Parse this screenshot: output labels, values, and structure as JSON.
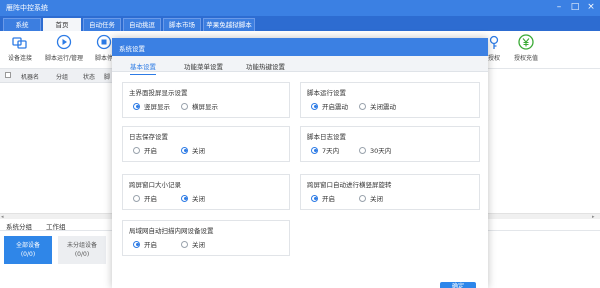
{
  "app": {
    "title": "雁阵中控系统"
  },
  "tabs": [
    {
      "label": "系统"
    },
    {
      "label": "首页"
    },
    {
      "label": "自动任务"
    },
    {
      "label": "自动挑逗"
    },
    {
      "label": "脚本市场"
    },
    {
      "label": "苹果免越狱脚本"
    }
  ],
  "toolbar": {
    "items": [
      {
        "label": "设备连接",
        "icon": "link-icon"
      },
      {
        "label": "脚本运行/管理",
        "icon": "play-icon"
      },
      {
        "label": "脚本停",
        "icon": "stop-icon"
      },
      {
        "label": "授权",
        "icon": "key-icon"
      },
      {
        "label": "授权充值",
        "icon": "yen-icon"
      }
    ]
  },
  "list": {
    "columns": [
      "机器名",
      "分组",
      "状态",
      "脚"
    ]
  },
  "bottom": {
    "tabs": [
      "系统分组",
      "工作组"
    ],
    "groups": [
      {
        "name": "全部设备",
        "count": "(0/0)"
      },
      {
        "name": "未分组设备",
        "count": "(0/0)"
      }
    ]
  },
  "modal": {
    "title": "系统设置",
    "tabs": [
      "基本设置",
      "功能菜单设置",
      "功能热键设置"
    ],
    "sections": [
      {
        "title": "主界面投屏显示设置",
        "options": [
          "竖屏显示",
          "横屏显示"
        ],
        "selected": 0
      },
      {
        "title": "脚本运行设置",
        "options": [
          "开启震动",
          "关闭震动"
        ],
        "selected": 0
      },
      {
        "title": "日志保存设置",
        "options": [
          "开启",
          "关闭"
        ],
        "selected": 1
      },
      {
        "title": "脚本日志设置",
        "options": [
          "7天内",
          "30天内"
        ],
        "selected": 0
      },
      {
        "title": "跨屏窗口大小记录",
        "options": [
          "开启",
          "关闭"
        ],
        "selected": 1
      },
      {
        "title": "跨屏窗口自动进行横竖屏旋转",
        "options": [
          "开启",
          "关闭"
        ],
        "selected": 0
      },
      {
        "title": "局域网自动扫描内网设备设置",
        "options": [
          "开启",
          "关闭"
        ],
        "selected": 0
      }
    ],
    "confirm_label": "确定"
  },
  "colors": {
    "primary": "#3b80e3",
    "accent": "#2d7be5"
  }
}
